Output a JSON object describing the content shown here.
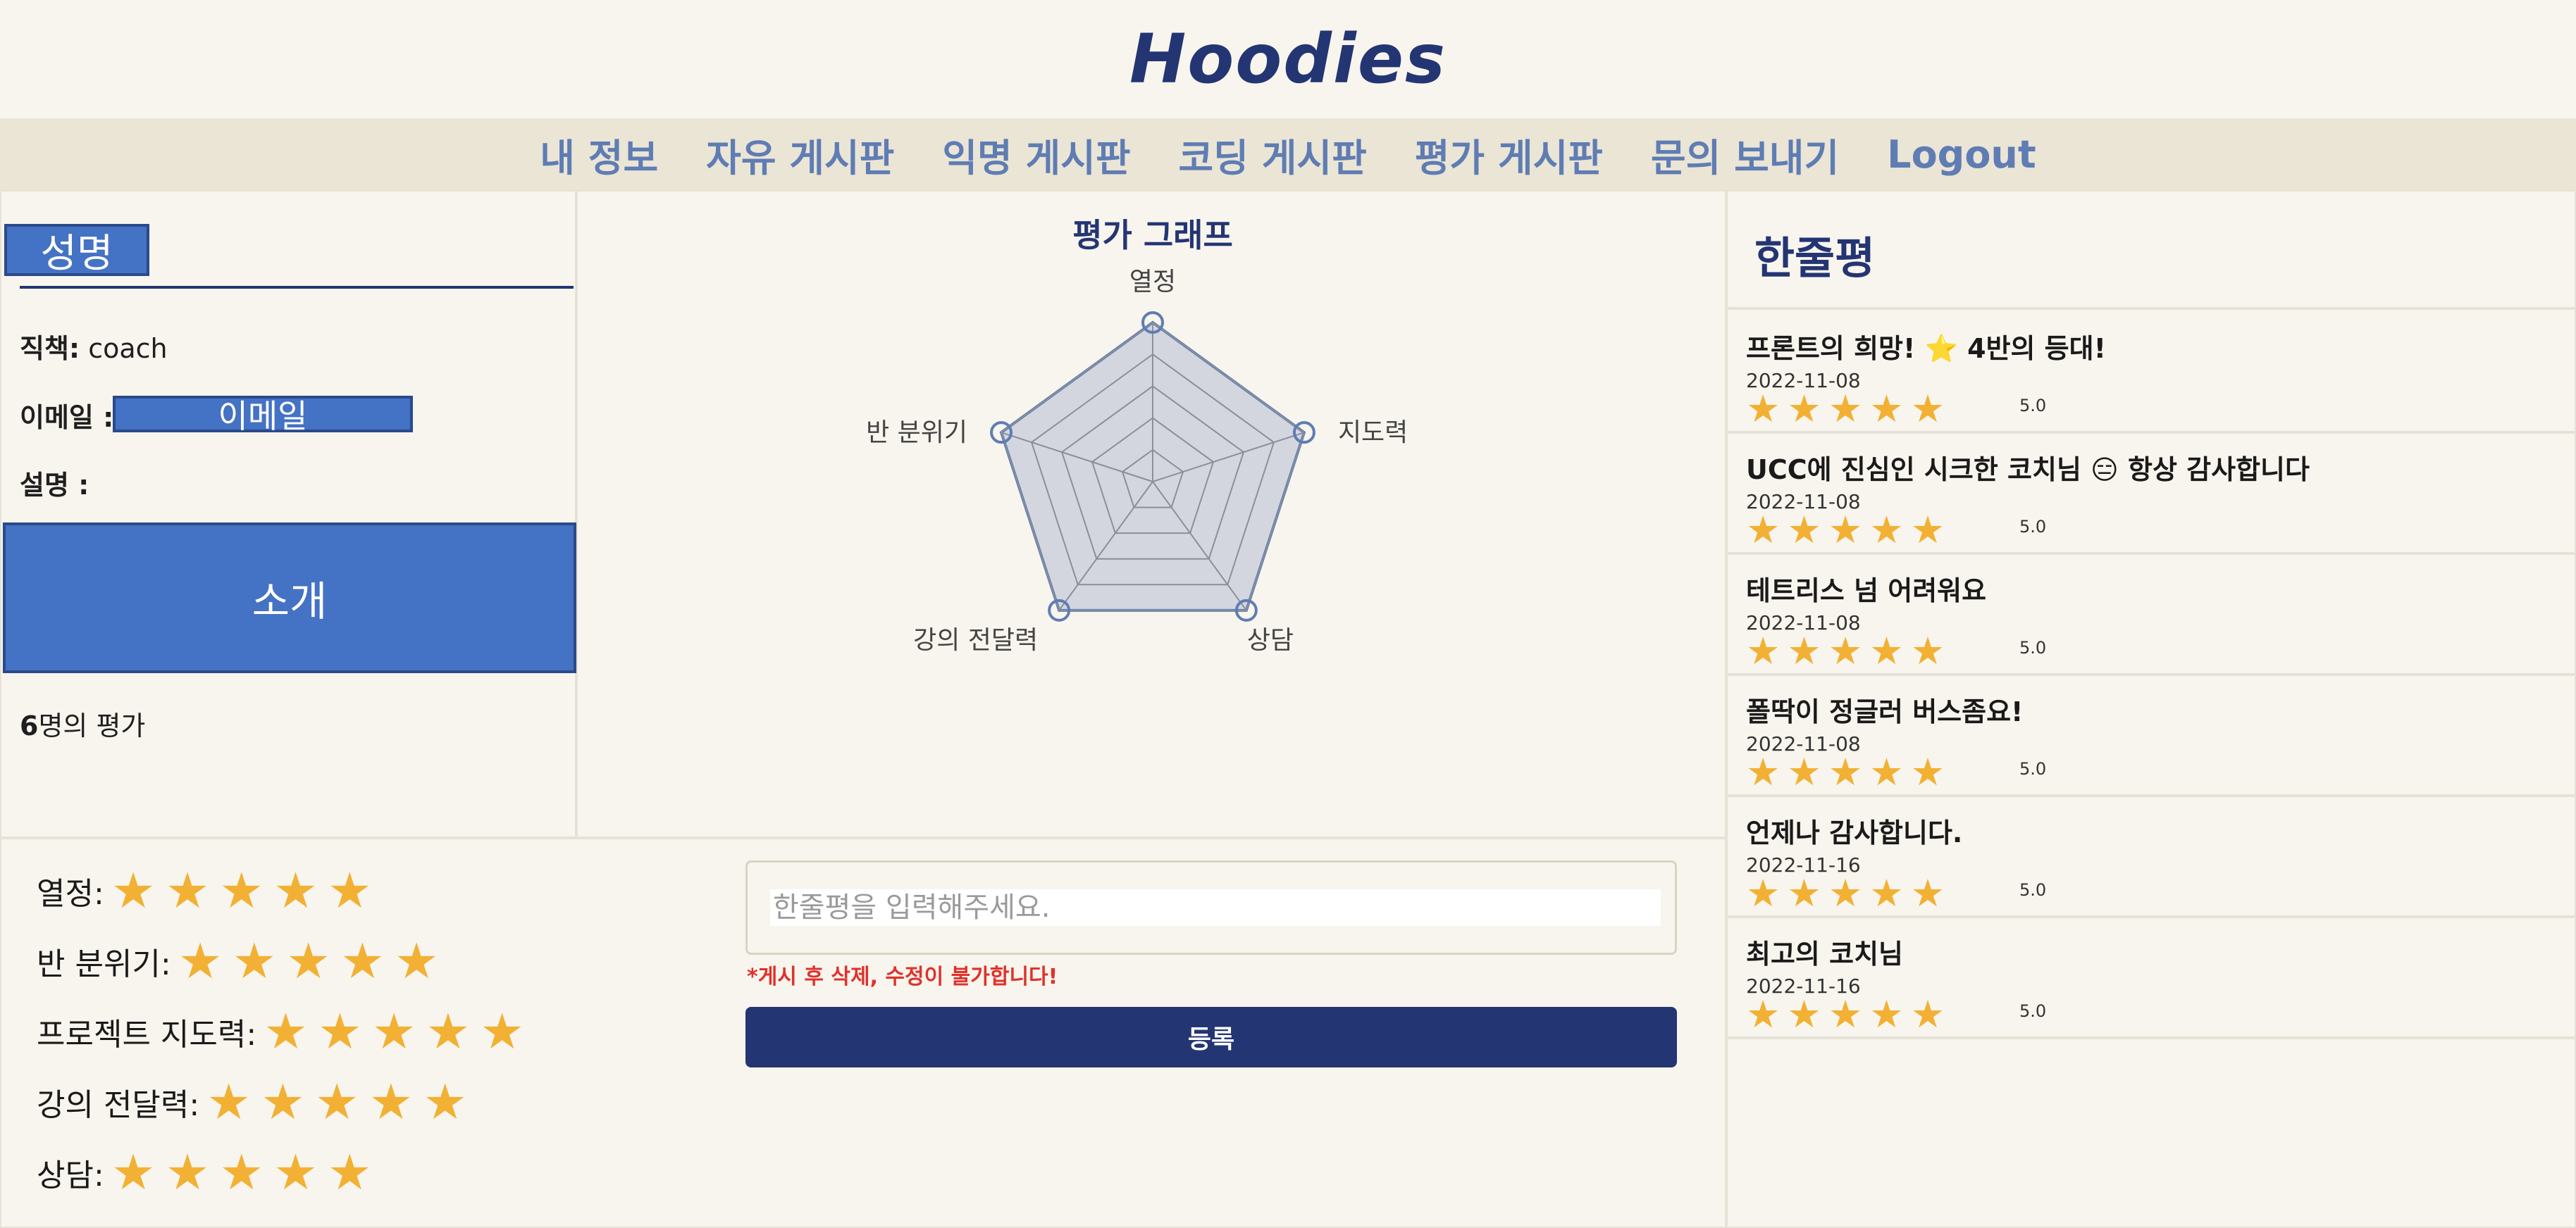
{
  "logo": "Hoodies",
  "nav": [
    "내 정보",
    "자유 게시판",
    "익명 게시판",
    "코딩 게시판",
    "평가 게시판",
    "문의 보내기",
    "Logout"
  ],
  "profile": {
    "name": "성명",
    "role_label": "직책:",
    "role_value": "coach",
    "email_label": "이메일 :",
    "email_value": "이메일",
    "desc_label": "설명 :",
    "intro": "소개",
    "rating_count": "6",
    "rating_count_suffix": "명의 평가"
  },
  "graph": {
    "title": "평가 그래프",
    "axes": [
      "열정",
      "지도력",
      "상담",
      "강의 전달력",
      "반 분위기"
    ],
    "values": [
      5,
      5,
      5,
      5,
      5
    ],
    "max": 5,
    "levels": 5,
    "fill": "#d3d6de",
    "stroke": "#5f7db3"
  },
  "reviews": {
    "title": "한줄평",
    "items": [
      {
        "text": "프론트의 희망! ⭐ 4반의 등대!",
        "date": "2022-11-08",
        "score": "5.0"
      },
      {
        "text": "UCC에 진심인 시크한 코치님 😑 항상 감사합니다",
        "date": "2022-11-08",
        "score": "5.0"
      },
      {
        "text": "테트리스 넘 어려워요",
        "date": "2022-11-08",
        "score": "5.0"
      },
      {
        "text": "폴딱이 정글러 버스좀요!",
        "date": "2022-11-08",
        "score": "5.0"
      },
      {
        "text": "언제나 감사합니다.",
        "date": "2022-11-16",
        "score": "5.0"
      },
      {
        "text": "최고의 코치님",
        "date": "2022-11-16",
        "score": "5.0"
      }
    ]
  },
  "ratings": [
    {
      "label": "열정:",
      "stars": 5
    },
    {
      "label": "반 분위기:",
      "stars": 5
    },
    {
      "label": "프로젝트 지도력:",
      "stars": 5
    },
    {
      "label": "강의 전달력:",
      "stars": 5
    },
    {
      "label": "상담:",
      "stars": 5
    }
  ],
  "review_form": {
    "placeholder": "한줄평을 입력해주세요.",
    "warning": "*게시 후 삭제, 수정이 불가합니다!",
    "submit": "등록"
  },
  "colors": {
    "accent": "#243573",
    "star": "#f2b134",
    "box": "#4472c4",
    "warning": "#e0312b"
  }
}
